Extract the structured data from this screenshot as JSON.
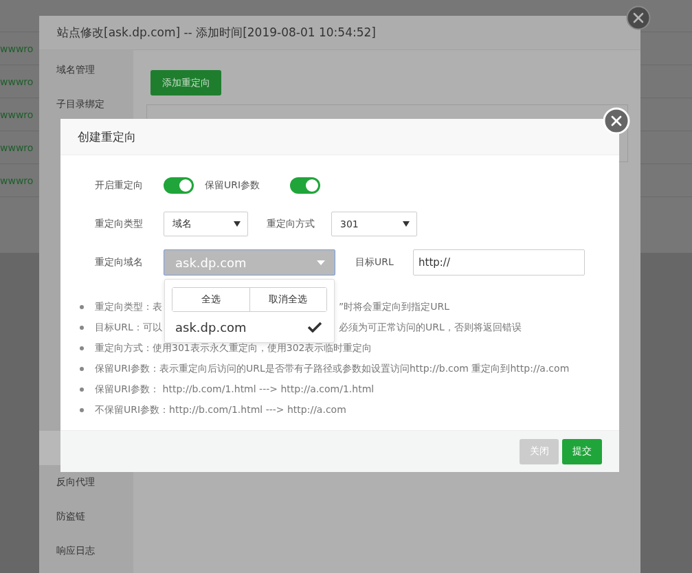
{
  "background": {
    "rows": [
      {
        "path": "wwwro"
      },
      {
        "path": "wwwro"
      },
      {
        "path": "wwwro"
      },
      {
        "path": "wwwro"
      },
      {
        "path": "wwwro"
      }
    ]
  },
  "site_dialog": {
    "title": "站点修改[ask.dp.com] -- 添加时间[2019-08-01 10:54:52]",
    "sidebar": [
      {
        "label": "域名管理",
        "selected": false
      },
      {
        "label": "子目录绑定",
        "selected": false
      },
      {
        "selected": true
      },
      {
        "label": "反向代理",
        "selected": false
      },
      {
        "label": "防盗链",
        "selected": false
      },
      {
        "label": "响应日志",
        "selected": false
      }
    ],
    "add_button": "添加重定向"
  },
  "redirect_dialog": {
    "title": "创建重定向",
    "toggles": [
      {
        "label": "开启重定向",
        "on": true
      },
      {
        "label": "保留URI参数",
        "on": true
      }
    ],
    "selects": [
      {
        "label": "重定向类型",
        "value": "域名"
      },
      {
        "label": "重定向方式",
        "value": "301"
      }
    ],
    "domain": {
      "label": "重定向域名",
      "value": "ask.dp.com",
      "expanded": true,
      "actions": [
        "全选",
        "取消全选"
      ],
      "options": [
        {
          "label": "ask.dp.com",
          "selected": true
        }
      ]
    },
    "target": {
      "label": "目标URL",
      "value": "http://"
    },
    "notes": [
      {
        "parts": [
          "重定向类型：表",
          "”时将会重定向到指定URL"
        ]
      },
      {
        "parts": [
          "目标URL：可以",
          "必须为可正常访问的URL，否则将返回错误"
        ]
      },
      {
        "parts": [
          "重定向方式：使用301表示永久重定向，使用302表示临时重定向"
        ]
      },
      {
        "parts": [
          "保留URI参数：表示重定向后访问的URL是否带有子路径或参数如设置访问http://b.com 重定向到http://a.com"
        ]
      },
      {
        "parts": [
          "保留URI参数：  http://b.com/1.html ---> http://a.com/1.html"
        ]
      },
      {
        "parts": [
          "不保留URI参数：http://b.com/1.html ---> http://a.com"
        ]
      }
    ],
    "buttons": [
      {
        "label": "关闭",
        "kind": "secondary"
      },
      {
        "label": "提交",
        "kind": "primary"
      }
    ]
  }
}
